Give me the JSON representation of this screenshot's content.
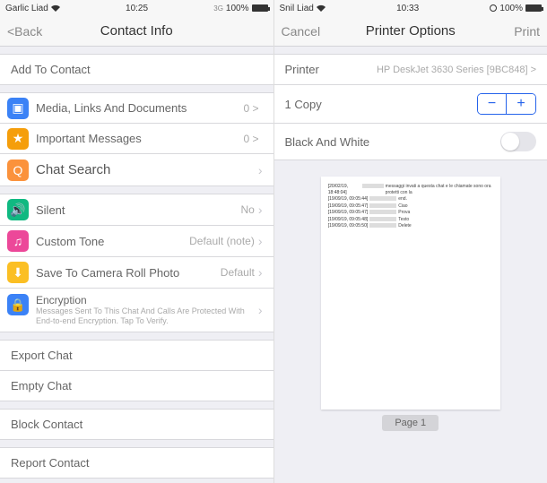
{
  "left": {
    "statusbar": {
      "carrier": "Garlic Liad",
      "time": "10:25",
      "battery": "100%",
      "signal_mode": "3G"
    },
    "navbar": {
      "back": "<Back",
      "title": "Contact Info"
    },
    "add_contact": "Add To Contact",
    "media": {
      "label": "Media, Links And Documents",
      "value": "0 >"
    },
    "important": {
      "label": "Important Messages",
      "value": "0 >"
    },
    "chat_search": {
      "label": "Chat Search"
    },
    "silent": {
      "label": "Silent",
      "value": "No"
    },
    "custom_tone": {
      "label": "Custom Tone",
      "value": "Default (note)"
    },
    "save_photo": {
      "label": "Save To Camera Roll Photo",
      "value": "Default"
    },
    "encryption": {
      "title": "Encryption",
      "sub": "Messages Sent To This Chat And Calls Are Protected With End-to-end Encryption. Tap To Verify."
    },
    "export": "Export Chat",
    "empty": "Empty Chat",
    "block": "Block Contact",
    "report": "Report Contact"
  },
  "right": {
    "statusbar": {
      "carrier": "Snil Liad",
      "time": "10:33",
      "battery": "100%"
    },
    "navbar": {
      "cancel": "Cancel",
      "title": "Printer Options",
      "print": "Print"
    },
    "printer": {
      "label": "Printer",
      "value": "HP DeskJet 3630 Series [9BC848] >"
    },
    "copies": {
      "label": "1 Copy"
    },
    "bw": {
      "label": "Black And White"
    },
    "page_label": "Page 1",
    "preview_lines": [
      {
        "ts": "[20/02/19, 18:48:04]",
        "text": "messaggi invati a questa chat e le chiamate sono ora protetti con la"
      },
      {
        "ts": "[19/09/19, 09:05:44]",
        "text": "end."
      },
      {
        "ts": "[19/09/19, 09:05:47]",
        "text": "Ciao"
      },
      {
        "ts": "[19/09/19, 09:05:47]",
        "text": "Prova"
      },
      {
        "ts": "[19/09/19, 09:05:48]",
        "text": "Testo"
      },
      {
        "ts": "[19/09/19, 09:05:50]",
        "text": "Delete"
      }
    ]
  }
}
